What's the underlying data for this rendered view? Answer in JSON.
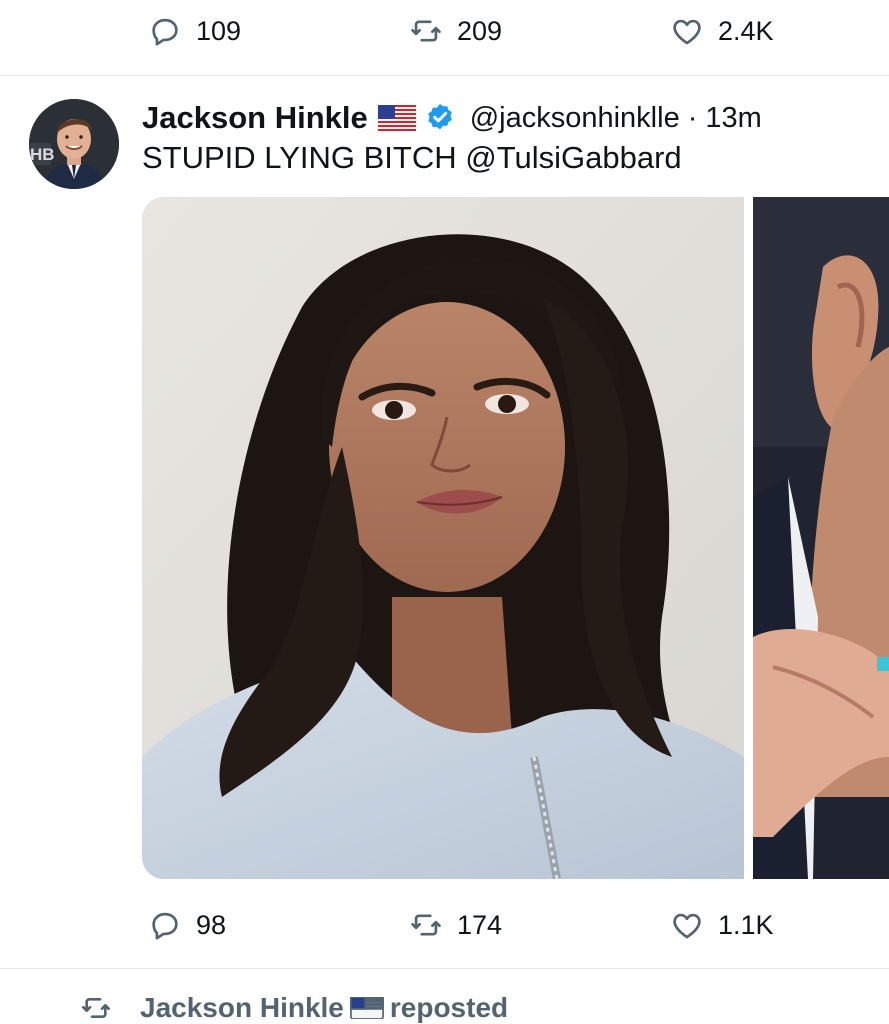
{
  "top_actions": {
    "replies": "109",
    "reposts": "209",
    "likes": "2.4K"
  },
  "tweet": {
    "author_name": "Jackson Hinkle",
    "handle": "@jacksonhinklle",
    "separator": "·",
    "time": "13m",
    "text_main": "STUPID LYING BITCH ",
    "mention": "@TulsiGabbard",
    "avatar_badge": "HB",
    "actions": {
      "replies": "98",
      "reposts": "174",
      "likes": "1.1K"
    }
  },
  "next_item": {
    "reposter_name": "Jackson Hinkle",
    "repost_label": "reposted"
  },
  "colors": {
    "text": "#0f1419",
    "icon": "#536471",
    "verified": "#1d9bf0",
    "divider": "#e4e7ea"
  }
}
